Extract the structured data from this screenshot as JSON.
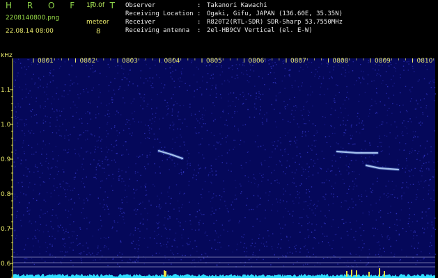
{
  "app": {
    "name": "H R O F F T",
    "version": "1.0.0f"
  },
  "file": {
    "name": "2208140800.png",
    "datetime": "22.08.14 08:00"
  },
  "meteor": {
    "label": "meteor",
    "count": "8"
  },
  "info": [
    {
      "key": "Observer",
      "value": "Takanori Kawachi"
    },
    {
      "key": "Receiving Location",
      "value": "Ogaki, Gifu, JAPAN (136.60E, 35.35N)"
    },
    {
      "key": "Receiver",
      "value": "R820T2(RTL-SDR) SDR-Sharp 53.7550MHz"
    },
    {
      "key": "Receiving antenna",
      "value": "2el-HB9CV Vertical (el. E-W)"
    }
  ],
  "spectrogram": {
    "y_unit": "kHz",
    "y_ticks": [
      "1.1",
      "1.0",
      "0.9",
      "0.8",
      "0.7",
      "0.6"
    ],
    "x_ticks": [
      "0801",
      "0802",
      "0803",
      "0804",
      "0805",
      "0806",
      "0807",
      "0808",
      "0809",
      "0810"
    ],
    "colors": {
      "background": "#05085a",
      "noise": "#3438c8",
      "trace": "#d8ecff",
      "axis": "#e8e86a",
      "level": "#30e0ff"
    }
  }
}
